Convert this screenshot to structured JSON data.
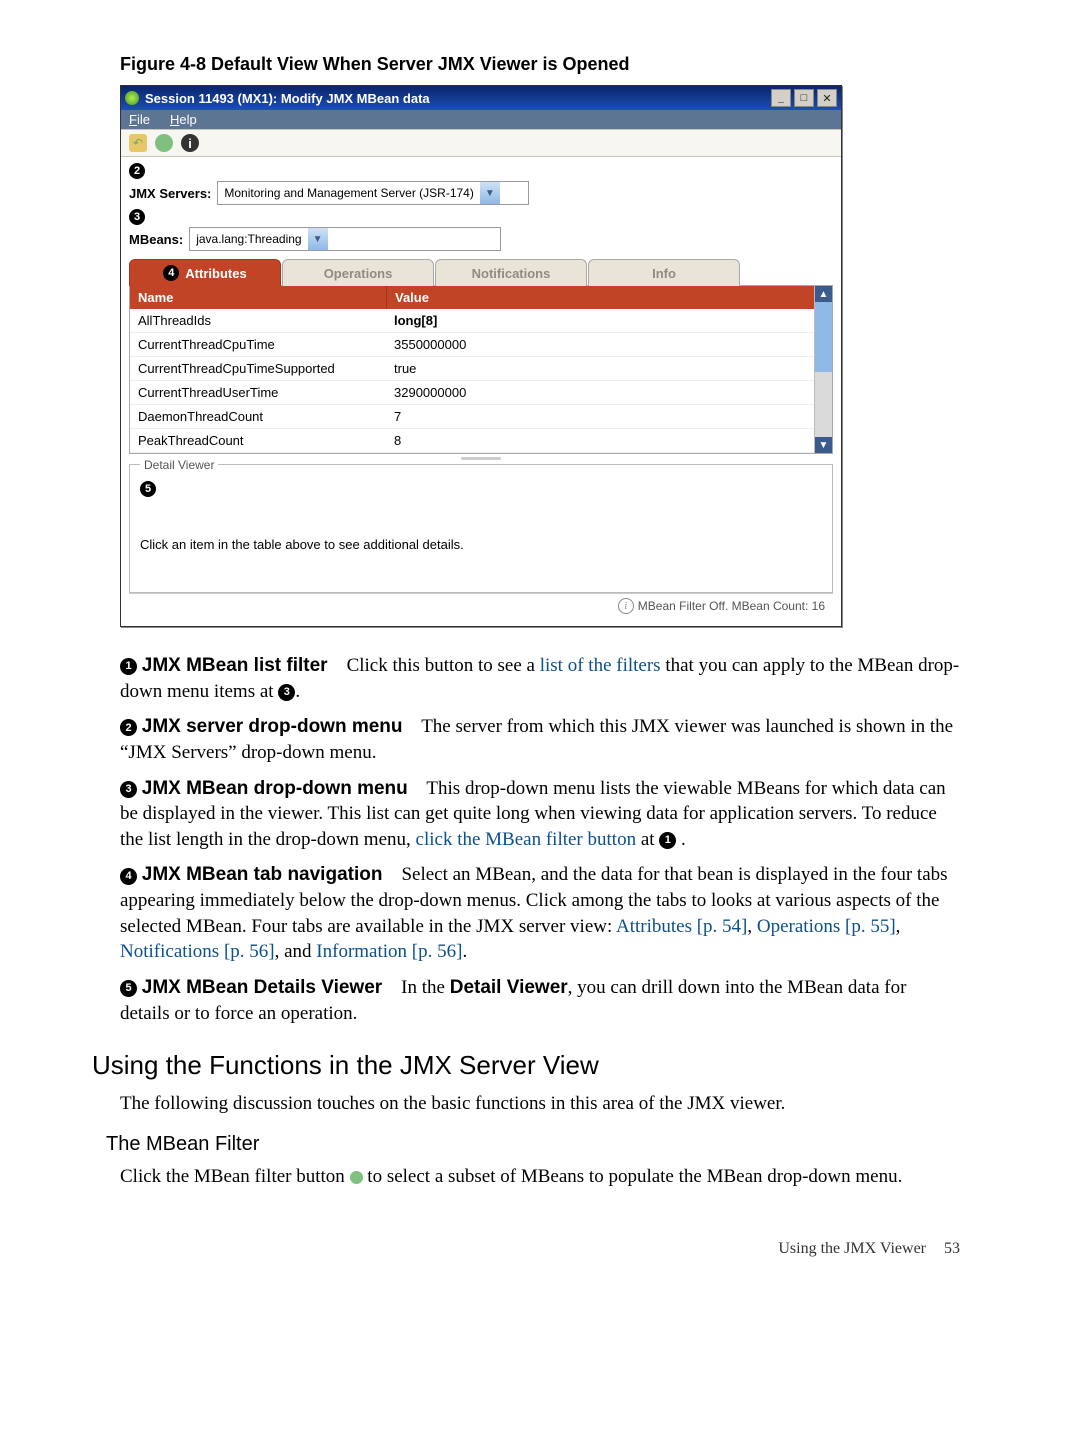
{
  "figure_caption": "Figure 4-8 Default View When Server JMX Viewer is Opened",
  "window": {
    "title": "Session 11493 (MX1): Modify JMX MBean data",
    "menu": {
      "file": "File",
      "file_u": "F",
      "help": "Help",
      "help_u": "H"
    },
    "toolbar": {
      "back_glyph": "↶",
      "help_glyph": "i"
    },
    "servers_label": "JMX Servers:",
    "servers_value": "Monitoring and Management Server (JSR-174)",
    "mbeans_label": "MBeans:",
    "mbeans_value": "java.lang:Threading",
    "tabs": {
      "attributes": "Attributes",
      "operations": "Operations",
      "notifications": "Notifications",
      "info": "Info"
    },
    "columns": {
      "name": "Name",
      "value": "Value"
    },
    "rows": [
      {
        "name": "AllThreadIds",
        "value": "long[8]"
      },
      {
        "name": "CurrentThreadCpuTime",
        "value": "3550000000"
      },
      {
        "name": "CurrentThreadCpuTimeSupported",
        "value": "true"
      },
      {
        "name": "CurrentThreadUserTime",
        "value": "3290000000"
      },
      {
        "name": "DaemonThreadCount",
        "value": "7"
      },
      {
        "name": "PeakThreadCount",
        "value": "8"
      }
    ],
    "detail_legend": "Detail Viewer",
    "detail_hint": "Click an item in the table above to see additional details.",
    "status": "MBean Filter Off. MBean Count: 16"
  },
  "para1_lead": "JMX MBean list filter",
  "para1_a": "Click this button to see a ",
  "para1_link": "list of the filters",
  "para1_b": " that you can apply to the MBean drop-down menu items at ",
  "para1_c": ".",
  "para2_lead": "JMX server drop-down menu",
  "para2_a": "The server from which this JMX viewer was launched is shown in the “JMX Servers” drop-down menu.",
  "para3_lead": "JMX MBean drop-down menu",
  "para3_a": "This drop-down menu lists the viewable MBeans for which data can be displayed in the viewer. This list can get quite long when viewing data for application servers. To reduce the list length in the drop-down menu, ",
  "para3_link": "click the MBean filter button",
  "para3_b": " at ",
  "para3_c": " .",
  "para4_lead": "JMX MBean tab navigation",
  "para4_a": "Select an MBean, and the data for that bean is displayed in the four tabs appearing immediately below the drop-down menus. Click among the tabs to looks at various aspects of the selected MBean. Four tabs are available in the JMX server view: ",
  "para4_l1": "Attributes [p. 54]",
  "para4_s1": ", ",
  "para4_l2": "Operations [p. 55]",
  "para4_s2": ", ",
  "para4_l3": "Notifications [p. 56]",
  "para4_s3": ", and ",
  "para4_l4": "Information [p. 56]",
  "para4_s4": ".",
  "para5_lead": "JMX MBean Details Viewer",
  "para5_a": "In the ",
  "para5_b": "Detail Viewer",
  "para5_c": ", you can drill down into the MBean data for details or to force an operation.",
  "h2": "Using the Functions in the JMX Server View",
  "h2_para": "The following discussion touches on the basic functions in this area of the JMX viewer.",
  "h3": "The MBean Filter",
  "h3_para_a": "Click the MBean filter button ",
  "h3_para_b": " to select a subset of MBeans to populate the MBean drop-down menu.",
  "footer_text": "Using the JMX Viewer",
  "footer_page": "53"
}
